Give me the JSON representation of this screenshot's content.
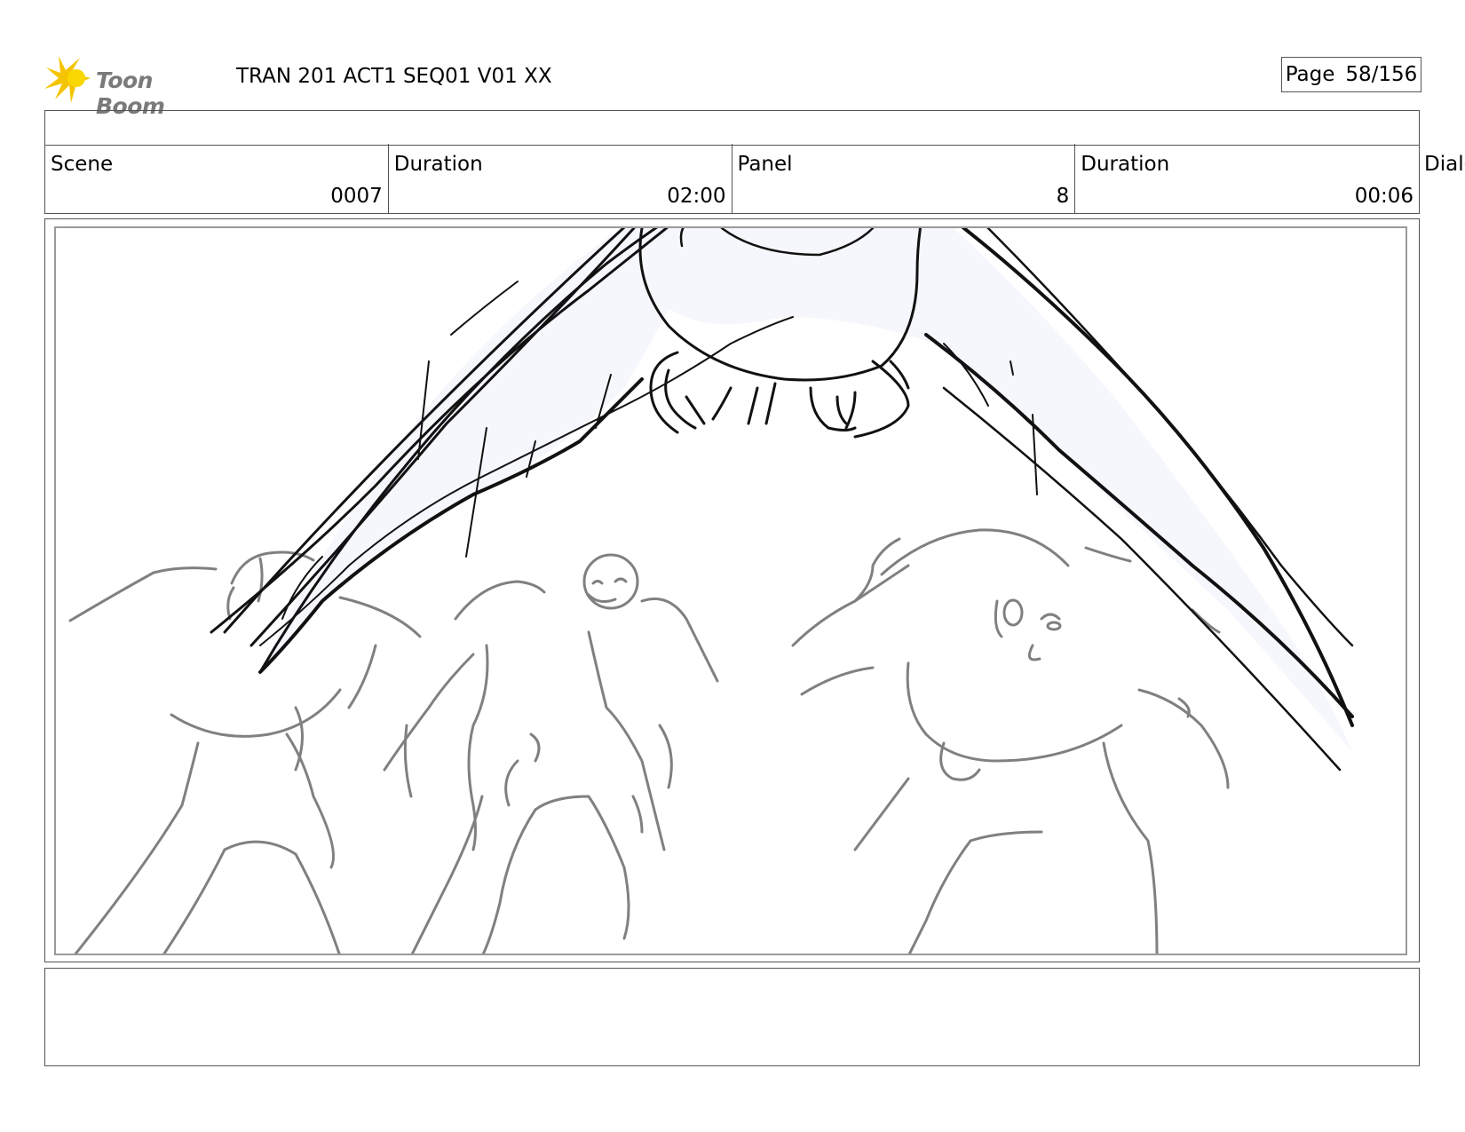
{
  "header": {
    "logo_text": "Toon Boom",
    "doc_title": "TRAN 201 ACT1 SEQ01 V01 XX",
    "page_label": "Page",
    "page_value": "58/156"
  },
  "info": {
    "scene_label": "Scene",
    "scene_value": "0007",
    "scene_duration_label": "Duration",
    "scene_duration_value": "02:00",
    "panel_label": "Panel",
    "panel_value": "8",
    "panel_duration_label": "Duration",
    "panel_duration_value": "00:06",
    "dialog_label": "Dialo"
  },
  "colors": {
    "logo_star": "#f5c400",
    "sketch_dark": "#111111",
    "sketch_gray": "#808080",
    "wing_fill": "#f5f7fc"
  }
}
